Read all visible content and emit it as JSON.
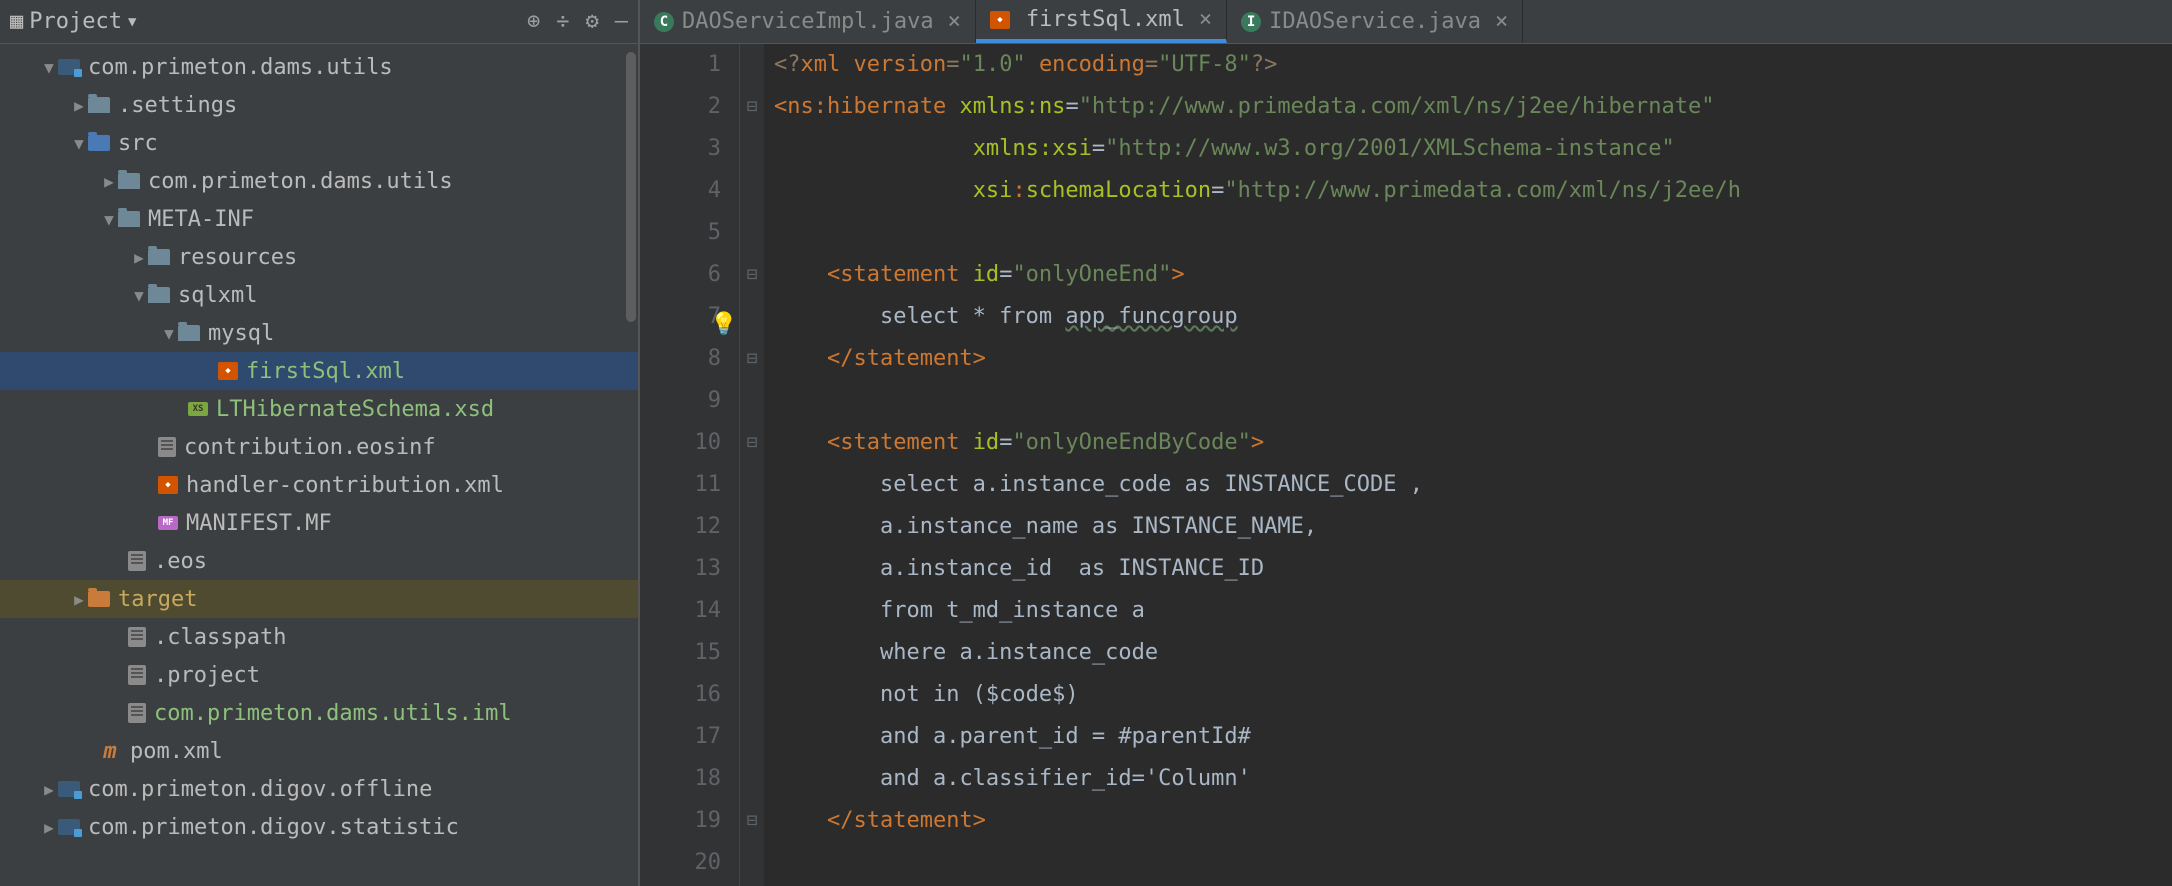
{
  "sidebar": {
    "title": "Project",
    "tree": [
      {
        "indent": 40,
        "arrow": "open",
        "icon": "module",
        "label": "com.primeton.dams.utils",
        "class": ""
      },
      {
        "indent": 70,
        "arrow": "closed",
        "icon": "folder",
        "label": ".settings",
        "class": ""
      },
      {
        "indent": 70,
        "arrow": "open",
        "icon": "folder-src",
        "label": "src",
        "class": ""
      },
      {
        "indent": 100,
        "arrow": "closed",
        "icon": "folder",
        "label": "com.primeton.dams.utils",
        "class": ""
      },
      {
        "indent": 100,
        "arrow": "open",
        "icon": "folder",
        "label": "META-INF",
        "class": ""
      },
      {
        "indent": 130,
        "arrow": "closed",
        "icon": "folder",
        "label": "resources",
        "class": ""
      },
      {
        "indent": 130,
        "arrow": "open",
        "icon": "folder",
        "label": "sqlxml",
        "class": ""
      },
      {
        "indent": 160,
        "arrow": "open",
        "icon": "folder",
        "label": "mysql",
        "class": ""
      },
      {
        "indent": 200,
        "arrow": "",
        "icon": "xml",
        "label": "firstSql.xml",
        "class": "green",
        "selected": true
      },
      {
        "indent": 170,
        "arrow": "",
        "icon": "xsd",
        "label": "LTHibernateSchema.xsd",
        "class": "green"
      },
      {
        "indent": 140,
        "arrow": "",
        "icon": "file",
        "label": "contribution.eosinf",
        "class": ""
      },
      {
        "indent": 140,
        "arrow": "",
        "icon": "xml",
        "label": "handler-contribution.xml",
        "class": ""
      },
      {
        "indent": 140,
        "arrow": "",
        "icon": "mf",
        "label": "MANIFEST.MF",
        "class": ""
      },
      {
        "indent": 110,
        "arrow": "",
        "icon": "file",
        "label": ".eos",
        "class": ""
      },
      {
        "indent": 70,
        "arrow": "closed",
        "icon": "folder-target",
        "label": "target",
        "class": "target-text",
        "highlighted": true
      },
      {
        "indent": 110,
        "arrow": "",
        "icon": "file",
        "label": ".classpath",
        "class": ""
      },
      {
        "indent": 110,
        "arrow": "",
        "icon": "file",
        "label": ".project",
        "class": ""
      },
      {
        "indent": 110,
        "arrow": "",
        "icon": "file",
        "label": "com.primeton.dams.utils.iml",
        "class": "green"
      },
      {
        "indent": 80,
        "arrow": "",
        "icon": "pom",
        "label": "pom.xml",
        "class": ""
      },
      {
        "indent": 40,
        "arrow": "closed",
        "icon": "module",
        "label": "com.primeton.digov.offline",
        "class": ""
      },
      {
        "indent": 40,
        "arrow": "closed",
        "icon": "module",
        "label": "com.primeton.digov.statistic",
        "class": ""
      }
    ]
  },
  "tabs": [
    {
      "icon": "c",
      "label": "DAOServiceImpl.java",
      "active": false
    },
    {
      "icon": "xml",
      "label": "firstSql.xml",
      "active": true
    },
    {
      "icon": "i",
      "label": "IDAOService.java",
      "active": false
    }
  ],
  "code": {
    "line_start": 1,
    "line_end": 20,
    "lines": [
      {
        "n": 1,
        "html": "<span class='xml-decl'>&lt;?</span><span class='keyword'>xml version</span><span class='xml-decl'>=</span><span class='string'>\"1.0\"</span> <span class='keyword'>encoding</span><span class='xml-decl'>=</span><span class='string'>\"UTF-8\"</span><span class='xml-decl'>?&gt;</span>"
      },
      {
        "n": 2,
        "fold": "⊟",
        "html": "<span class='tag'>&lt;</span><span class='ns'>ns</span><span class='tag'>:</span><span class='tag'>hibernate </span><span class='attr'>xmlns:</span><span class='attr'>ns</span><span class='text'>=</span><span class='string'>\"http://www.primedata.com/xml/ns/j2ee/hibernate\"</span>"
      },
      {
        "n": 3,
        "html": "               <span class='attr'>xmlns:</span><span class='attr'>xsi</span><span class='text'>=</span><span class='string'>\"http://www.w3.org/2001/XMLSchema-instance\"</span>"
      },
      {
        "n": 4,
        "html": "               <span class='attr'>xsi</span><span class='tag'>:</span><span class='attr'>schemaLocation</span><span class='text'>=</span><span class='string'>\"http://www.primedata.com/xml/ns/j2ee/h</span>"
      },
      {
        "n": 5,
        "html": ""
      },
      {
        "n": 6,
        "fold": "⊟",
        "html": "    <span class='tag'>&lt;statement </span><span class='attr'>id</span><span class='text'>=</span><span class='string'>\"onlyOneEnd\"</span><span class='tag'>&gt;</span>"
      },
      {
        "n": 7,
        "bulb": true,
        "html": "        <span class='text'>select * from </span><span class='underline-squiggle'>app_funcgroup</span>"
      },
      {
        "n": 8,
        "fold": "⊟",
        "html": "    <span class='tag'>&lt;/statement&gt;</span>"
      },
      {
        "n": 9,
        "html": ""
      },
      {
        "n": 10,
        "fold": "⊟",
        "html": "    <span class='tag'>&lt;statement </span><span class='attr'>id</span><span class='text'>=</span><span class='string'>\"onlyOneEndByCode\"</span><span class='tag'>&gt;</span>"
      },
      {
        "n": 11,
        "html": "        <span class='text'>select a.instance_code as INSTANCE_CODE ,</span>"
      },
      {
        "n": 12,
        "html": "        <span class='text'>a.instance_name as INSTANCE_NAME,</span>"
      },
      {
        "n": 13,
        "html": "        <span class='text'>a.instance_id  as INSTANCE_ID</span>"
      },
      {
        "n": 14,
        "html": "        <span class='text'>from t_md_instance a</span>"
      },
      {
        "n": 15,
        "html": "        <span class='text'>where a.instance_code</span>"
      },
      {
        "n": 16,
        "html": "        <span class='text'>not in ($code$)</span>"
      },
      {
        "n": 17,
        "html": "        <span class='text'>and a.parent_id = #parentId#</span>"
      },
      {
        "n": 18,
        "html": "        <span class='text'>and a.classifier_id='Column'</span>"
      },
      {
        "n": 19,
        "fold": "⊟",
        "html": "    <span class='tag'>&lt;/statement&gt;</span>"
      },
      {
        "n": 20,
        "html": ""
      }
    ]
  }
}
